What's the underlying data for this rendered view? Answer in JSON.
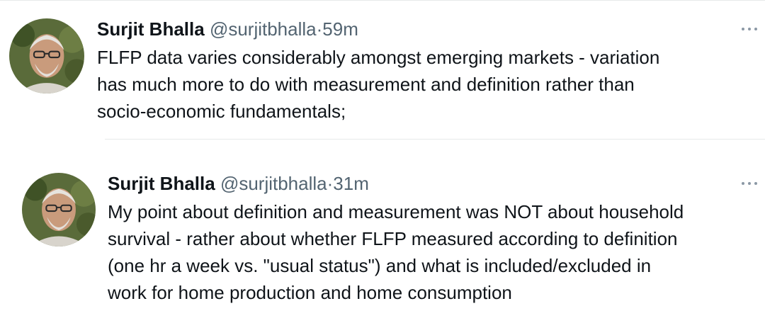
{
  "tweets": [
    {
      "author_name": "Surjit Bhalla",
      "handle": "@surjitbhalla",
      "separator": "·",
      "time": "59m",
      "more_icon": "more-horizontal-icon",
      "lines": [
        "FLFP data varies considerably amongst emerging markets - variation",
        "has much more to do with measurement and definition rather than",
        "socio-economic fundamentals;"
      ]
    },
    {
      "author_name": "Surjit Bhalla",
      "handle": "@surjitbhalla",
      "separator": "·",
      "time": "31m",
      "more_icon": "more-horizontal-icon",
      "lines": [
        "My point about definition and measurement was NOT about household",
        "survival - rather about whether FLFP measured according to definition",
        "(one hr a week vs. \"usual status\") and what is included/excluded in",
        "work for home production and home consumption"
      ]
    }
  ],
  "colors": {
    "text_primary": "#0f1419",
    "text_secondary": "#536471",
    "divider": "#e7e9ea"
  }
}
